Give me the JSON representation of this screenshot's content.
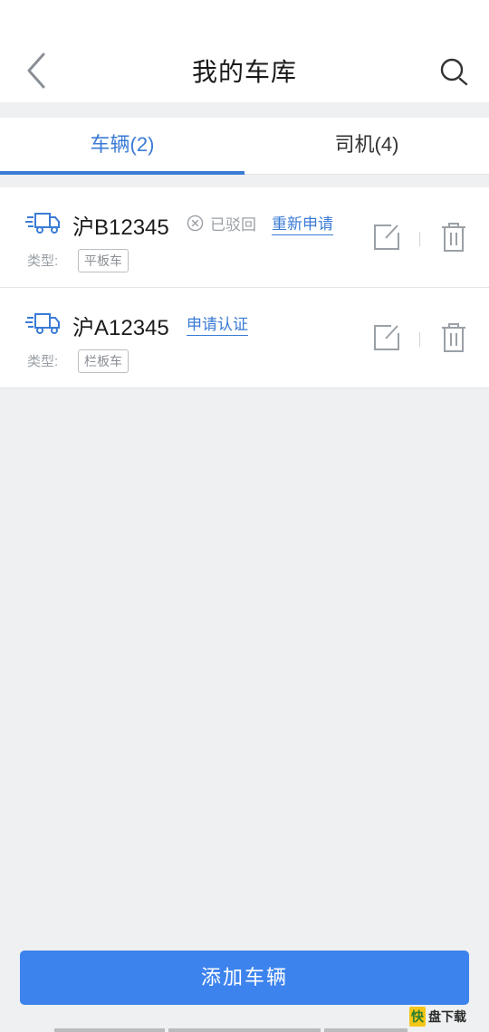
{
  "header": {
    "title": "我的车库",
    "back_icon": "chevron-left-icon",
    "search_icon": "search-icon"
  },
  "tabs": [
    {
      "label": "车辆(2)",
      "active": true
    },
    {
      "label": "司机(4)",
      "active": false
    }
  ],
  "vehicles": [
    {
      "plate": "沪B12345",
      "status": "已驳回",
      "action": "重新申请",
      "type_label": "类型:",
      "type": "平板车"
    },
    {
      "plate": "沪A12345",
      "status": "",
      "action": "申请认证",
      "type_label": "类型:",
      "type": "栏板车"
    }
  ],
  "footer": {
    "add_button": "添加车辆"
  },
  "watermark": {
    "logo_char": "快",
    "text": "盘下载"
  },
  "colors": {
    "accent": "#3a7bd5",
    "button": "#3d83ee",
    "background": "#eef0f1"
  }
}
